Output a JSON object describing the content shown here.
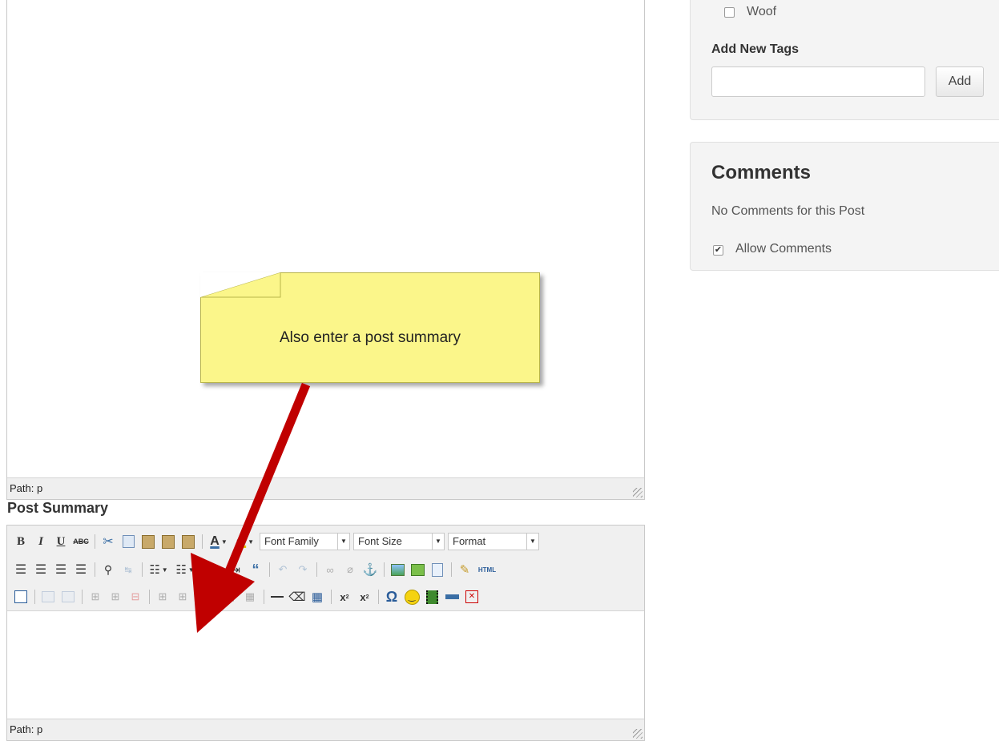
{
  "main_editor": {
    "path_label": "Path: p"
  },
  "post_summary": {
    "heading": "Post Summary",
    "path_label": "Path: p",
    "toolbar": {
      "row1": {
        "bold": "B",
        "italic": "I",
        "underline": "U",
        "strike": "ABC",
        "font_color": "A",
        "highlight": "ab",
        "font_family": "Font Family",
        "font_size": "Font Size",
        "format": "Format"
      },
      "row2": {
        "html": "HTML"
      },
      "row3": {
        "subscript": "x",
        "superscript": "x",
        "omega": "Ω"
      }
    }
  },
  "tags": {
    "items": [
      {
        "label": "Woof",
        "checked": false
      }
    ],
    "add_new_label": "Add New Tags",
    "input_value": "",
    "add_button": "Add"
  },
  "comments": {
    "title": "Comments",
    "status": "No Comments for this Post",
    "allow_label": "Allow Comments",
    "allow_checked": true
  },
  "annotation": {
    "text": "Also enter a post summary"
  },
  "colors": {
    "note_bg": "#fbf68a",
    "arrow": "#c00000",
    "panel_bg": "#f4f4f4"
  },
  "icons": [
    "cut-icon",
    "copy-icon",
    "paste-icon",
    "paste-text-icon",
    "paste-word-icon",
    "align-left-icon",
    "align-center-icon",
    "align-right-icon",
    "justify-icon",
    "find-icon",
    "replace-icon",
    "bullet-list-icon",
    "numbered-list-icon",
    "outdent-icon",
    "indent-icon",
    "blockquote-icon",
    "undo-icon",
    "redo-icon",
    "link-icon",
    "unlink-icon",
    "anchor-icon",
    "image-icon",
    "media-icon",
    "document-icon",
    "cleanup-icon",
    "edit-icon",
    "table-icon",
    "hr-icon",
    "eraser-icon",
    "subscript-icon",
    "superscript-icon",
    "omega-icon",
    "smiley-icon",
    "film-icon",
    "abbr-icon",
    "pdf-icon"
  ]
}
